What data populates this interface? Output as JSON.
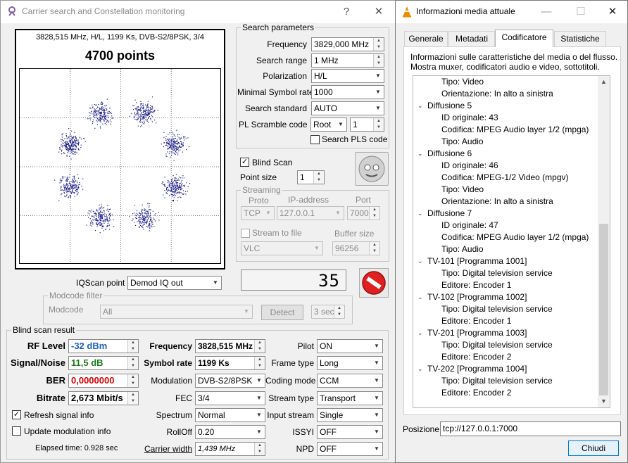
{
  "left_window": {
    "title": "Carrier search and Constellation monitoring",
    "help": "?",
    "close": "✕",
    "info_line": "3828,515 MHz, H/L, 1199 Ks, DVB-S2/8PSK, 3/4",
    "points": "4700 points",
    "iqscan_label": "IQScan point",
    "iqscan_value": "Demod IQ out",
    "level_display": "35",
    "search": {
      "group": "Search parameters",
      "frequency_label": "Frequency",
      "frequency_value": "3829,000 MHz",
      "range_label": "Search range",
      "range_value": "1 MHz",
      "polarization_label": "Polarization",
      "polarization_value": "H/L",
      "msr_label": "Minimal Symbol rate",
      "msr_value": "1000",
      "standard_label": "Search standard",
      "standard_value": "AUTO",
      "pls_label": "PL Scramble code",
      "pls_mode": "Root",
      "pls_value": "1",
      "search_pls": "Search PLS code"
    },
    "blind_scan": "Blind Scan",
    "point_size_label": "Point size",
    "point_size_value": "1",
    "streaming": {
      "group": "Streaming",
      "proto_label": "Proto",
      "proto_value": "TCP",
      "ip_label": "IP-address",
      "ip_value": "127.0.0.1",
      "port_label": "Port",
      "port_value": "7000",
      "stream_to_file": "Stream to file",
      "buffer_label": "Buffer size",
      "buffer_value": "96256",
      "app_value": "VLC"
    },
    "modcode": {
      "group": "Modcode filter",
      "label": "Modcode",
      "value": "All",
      "detect": "Detect",
      "time": "3 sec"
    },
    "result": {
      "group": "Blind scan result",
      "rf_label": "RF Level",
      "rf_value": "-32 dBm",
      "sn_label": "Signal/Noise",
      "sn_value": "11,5 dB",
      "ber_label": "BER",
      "ber_value": "0,0000000",
      "bitrate_label": "Bitrate",
      "bitrate_value": "2,673 Mbit/s",
      "freq_label": "Frequency",
      "freq_value": "3828,515 MHz",
      "sr_label": "Symbol rate",
      "sr_value": "1199 Ks",
      "mod_label": "Modulation",
      "mod_value": "DVB-S2/8PSK",
      "fec_label": "FEC",
      "fec_value": "3/4",
      "spectrum_label": "Spectrum",
      "spectrum_value": "Normal",
      "rolloff_label": "RollOff",
      "rolloff_value": "0.20",
      "cw_label": "Carrier width",
      "cw_value": "1,439 MHz",
      "pilot_label": "Pilot",
      "pilot_value": "ON",
      "frame_label": "Frame type",
      "frame_value": "Long",
      "coding_label": "Coding mode",
      "coding_value": "CCM",
      "stype_label": "Stream type",
      "stype_value": "Transport",
      "input_label": "Input stream",
      "input_value": "Single",
      "issyi_label": "ISSYI",
      "issyi_value": "OFF",
      "npd_label": "NPD",
      "npd_value": "OFF",
      "refresh": "Refresh signal info",
      "update": "Update modulation info",
      "elapsed": "Elapsed time: 0.928 sec"
    }
  },
  "right_window": {
    "title": "Informazioni media attuale",
    "tabs": [
      "Generale",
      "Metadati",
      "Codificatore",
      "Statistiche"
    ],
    "description": [
      "Informazioni sulle caratteristiche del media o del flusso.",
      "Mostra muxer, codificatori audio e video, sottotitoli."
    ],
    "tree": [
      {
        "lvl": 2,
        "text": "Tipo: Video"
      },
      {
        "lvl": 2,
        "text": "Orientazione: In alto a sinistra"
      },
      {
        "lvl": 1,
        "text": "Diffusione 5"
      },
      {
        "lvl": 2,
        "text": "ID originale: 43"
      },
      {
        "lvl": 2,
        "text": "Codifica: MPEG Audio layer 1/2 (mpga)"
      },
      {
        "lvl": 2,
        "text": "Tipo: Audio"
      },
      {
        "lvl": 1,
        "text": "Diffusione 6"
      },
      {
        "lvl": 2,
        "text": "ID originale: 46"
      },
      {
        "lvl": 2,
        "text": "Codifica: MPEG-1/2 Video (mpgv)"
      },
      {
        "lvl": 2,
        "text": "Tipo: Video"
      },
      {
        "lvl": 2,
        "text": "Orientazione: In alto a sinistra"
      },
      {
        "lvl": 1,
        "text": "Diffusione 7"
      },
      {
        "lvl": 2,
        "text": "ID originale: 47"
      },
      {
        "lvl": 2,
        "text": "Codifica: MPEG Audio layer 1/2 (mpga)"
      },
      {
        "lvl": 2,
        "text": "Tipo: Audio"
      },
      {
        "lvl": 1,
        "text": "TV-101 [Programma 1001]"
      },
      {
        "lvl": 2,
        "text": "Tipo: Digital television service"
      },
      {
        "lvl": 2,
        "text": "Editore: Encoder 1"
      },
      {
        "lvl": 1,
        "text": "TV-102 [Programma 1002]"
      },
      {
        "lvl": 2,
        "text": "Tipo: Digital television service"
      },
      {
        "lvl": 2,
        "text": "Editore: Encoder 1"
      },
      {
        "lvl": 1,
        "text": "TV-201 [Programma 1003]"
      },
      {
        "lvl": 2,
        "text": "Tipo: Digital television service"
      },
      {
        "lvl": 2,
        "text": "Editore: Encoder 2"
      },
      {
        "lvl": 1,
        "text": "TV-202 [Programma 1004]"
      },
      {
        "lvl": 2,
        "text": "Tipo: Digital television service"
      },
      {
        "lvl": 2,
        "text": "Editore: Encoder 2"
      }
    ],
    "position_label": "Posizione:",
    "position_value": "tcp://127.0.0.1:7000",
    "close_button": "Chiudi"
  },
  "colors": {
    "dots": "#1a1a8c",
    "rf": "#1f5fbf",
    "sn": "#1a7a1a",
    "ber": "#d40000",
    "accent": "#0078d7"
  }
}
